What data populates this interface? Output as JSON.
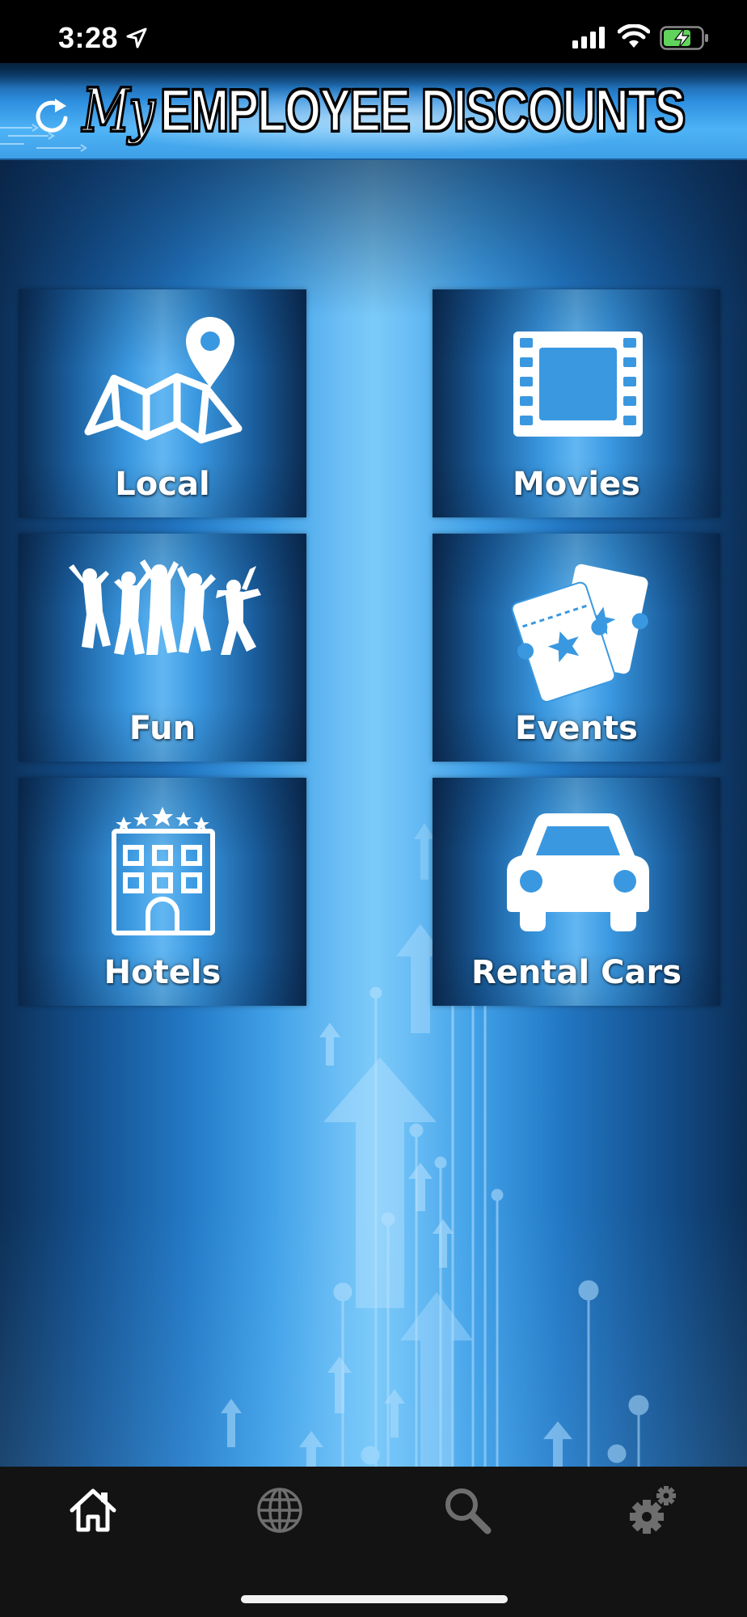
{
  "status_bar": {
    "time": "3:28",
    "icons": [
      "location-arrow-icon",
      "cellular-signal-icon",
      "wifi-icon",
      "battery-charging-icon"
    ]
  },
  "header": {
    "title_prefix": "My",
    "title_main": "EMPLOYEE DISCOUNTS",
    "refresh_icon": "refresh-icon"
  },
  "tiles": [
    {
      "label": "Local",
      "icon": "map-pin-icon"
    },
    {
      "label": "Movies",
      "icon": "film-strip-icon"
    },
    {
      "label": "Fun",
      "icon": "people-jumping-icon"
    },
    {
      "label": "Events",
      "icon": "tickets-icon"
    },
    {
      "label": "Hotels",
      "icon": "hotel-icon"
    },
    {
      "label": "Rental Cars",
      "icon": "car-icon"
    }
  ],
  "tab_bar": {
    "tabs": [
      {
        "icon": "home-icon",
        "selected": true
      },
      {
        "icon": "globe-icon",
        "selected": false
      },
      {
        "icon": "search-icon",
        "selected": false
      },
      {
        "icon": "gear-icon",
        "selected": false
      }
    ]
  },
  "colors": {
    "accent": "#4eb3f6",
    "tab_bar": "#131313",
    "tab_icon_selected": "#ffffff",
    "tab_icon_unselected": "#6e6e6e"
  }
}
